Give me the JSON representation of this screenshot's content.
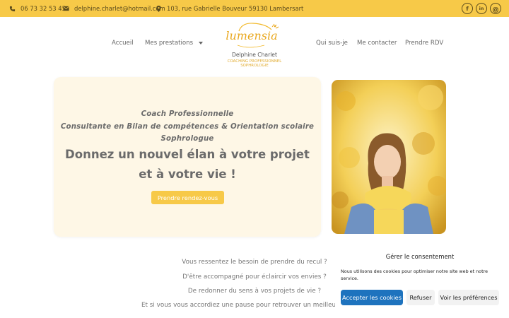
{
  "topbar": {
    "phone": "06 73 32 53 45",
    "email": "delphine.charlet@hotmail.com",
    "address": "103, rue Gabrielle Bouveur 59130 Lambersart",
    "socials": [
      "facebook-icon",
      "linkedin-icon",
      "instagram-icon"
    ],
    "bg_color": "#f7c948"
  },
  "logo": {
    "brand": "lumensia",
    "name": "Delphine Charlet",
    "subtitle_1": "COACHING PROFESSIONNEL",
    "subtitle_2": "SOPHROLOGIE"
  },
  "nav": {
    "home": "Accueil",
    "services": "Mes prestations",
    "about": "Qui suis-je",
    "contact": "Me contacter",
    "booking": "Prendre RDV"
  },
  "hero": {
    "line1": "Coach Professionnelle",
    "line2": "Consultante en Bilan de compétences & Orientation scolaire",
    "line3": "Sophrologue",
    "title1": "Donnez un nouvel élan à votre projet",
    "title2": "et à votre vie !",
    "cta": "Prendre rendez-vous"
  },
  "body": {
    "q1": "Vous ressentez le besoin de prendre du recul ?",
    "q2": "D'être accompagné pour éclaircir vos envies ?",
    "q3": "De redonner du sens à vos projets de vie ?",
    "q4": "Et si vous vous accordiez une pause pour retrouver un meilleur éq"
  },
  "consent": {
    "title": "Gérer le consentement",
    "text": "Nous utilisons des cookies pour optimiser notre site web et notre service.",
    "accept": "Accepter les cookies",
    "refuse": "Refuser",
    "preferences": "Voir les préférences",
    "accent": "#1e73be"
  }
}
